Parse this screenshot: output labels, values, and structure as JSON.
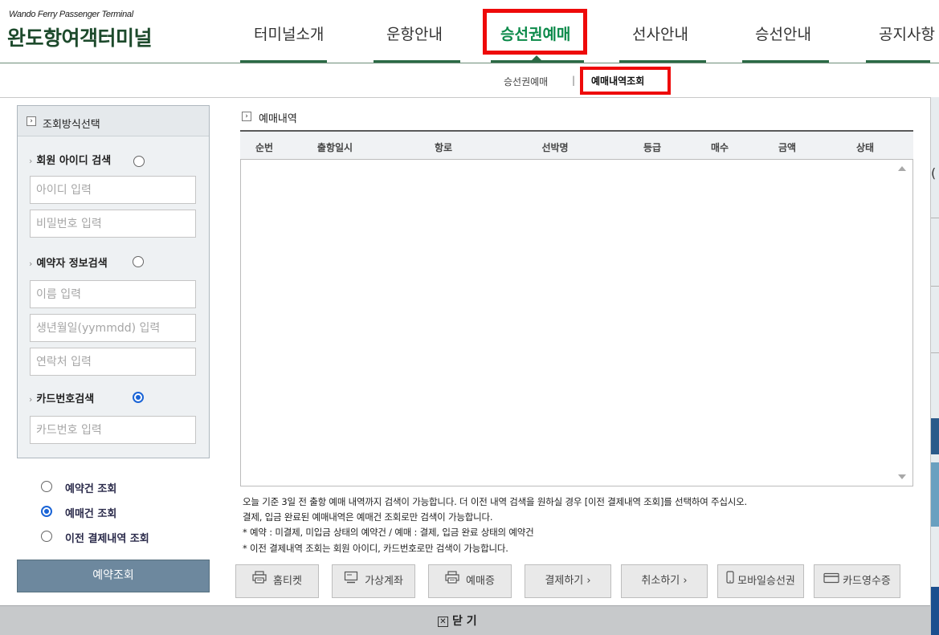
{
  "header": {
    "logo_en": "Wando Ferry Passenger Terminal",
    "logo_ko": "완도항여객터미널",
    "nav": [
      {
        "label": "터미널소개",
        "active": false
      },
      {
        "label": "운항안내",
        "active": false
      },
      {
        "label": "승선권예매",
        "active": true
      },
      {
        "label": "선사안내",
        "active": false
      },
      {
        "label": "승선안내",
        "active": false
      },
      {
        "label": "공지사항",
        "active": false
      }
    ],
    "subnav": {
      "item1": "승선권예매",
      "separator": "|",
      "item2_active": "예매내역조회"
    }
  },
  "search_panel": {
    "title": "조회방식선택",
    "member": {
      "label": "회원 아이디 검색",
      "id_placeholder": "아이디 입력",
      "pw_placeholder": "비밀번호 입력",
      "selected": false
    },
    "booker": {
      "label": "예약자 정보검색",
      "name_placeholder": "이름 입력",
      "birth_placeholder": "생년월일(yymmdd) 입력",
      "phone_placeholder": "연락처 입력",
      "selected": false
    },
    "card": {
      "label": "카드번호검색",
      "card_placeholder": "카드번호 입력",
      "selected": true
    }
  },
  "query_options": [
    {
      "label": "예약건 조회",
      "selected": false
    },
    {
      "label": "예매건 조회",
      "selected": true
    },
    {
      "label": "이전 결제내역 조회",
      "selected": false
    }
  ],
  "search_button": "예약조회",
  "results": {
    "title": "예매내역",
    "columns": [
      "순번",
      "출항일시",
      "항로",
      "선박명",
      "등급",
      "매수",
      "금액",
      "상태"
    ],
    "rows": []
  },
  "notices": [
    "오늘 기준 3일 전 출항 예매 내역까지 검색이 가능합니다. 더 이전 내역 검색을 원하실 경우 [이전 결제내역 조회]를 선택하여 주십시오.",
    "결제, 입금 완료된 예매내역은 예매건 조회로만 검색이 가능합니다.",
    "* 예약 : 미결제, 미입금 상태의 예약건 / 예매 : 결제, 입금 완료 상태의 예약건",
    "* 이전 결제내역 조회는 회원 아이디, 카드번호로만 검색이 가능합니다."
  ],
  "actions": {
    "home_ticket": "홈티켓",
    "virtual_account": "가상계좌",
    "ticket_cert": "예매증",
    "pay": "결제하기 ›",
    "cancel": "취소하기 ›",
    "mobile_ticket": "모바일승선권",
    "card_receipt": "카드영수증"
  },
  "close_label": "닫 기",
  "colors": {
    "brand_green": "#0c8a4a",
    "highlight_red": "#ee0a0a",
    "radio_blue": "#1a64d6",
    "search_button_bg": "#6d889e"
  }
}
